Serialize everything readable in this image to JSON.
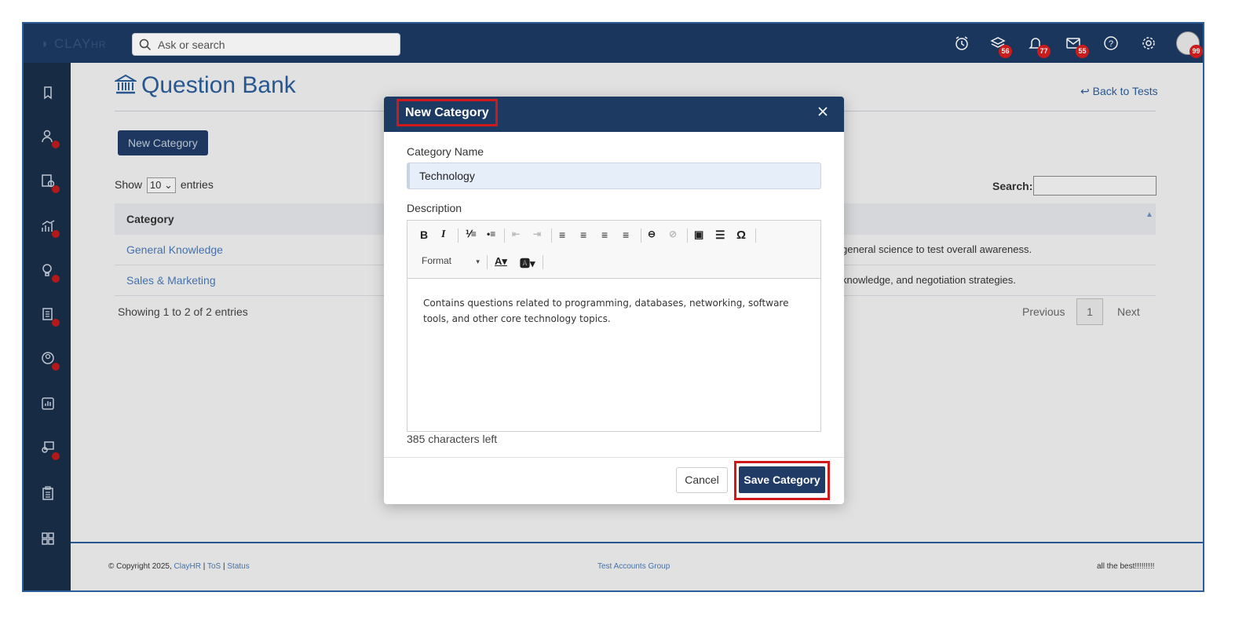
{
  "app": {
    "logo": "CLAY",
    "logo_suffix": "HR",
    "search_placeholder": "Ask or search",
    "badges": {
      "stack": "56",
      "bell": "77",
      "mail": "55",
      "avatar": "99"
    }
  },
  "page": {
    "title": "Question Bank",
    "back_link": "Back to Tests",
    "new_category_button": "New Category",
    "show_label": "Show",
    "entries_value": "10",
    "entries_label": "entries",
    "search_label": "Search:",
    "table": {
      "header": "Category",
      "rows": [
        {
          "category": "General Knowledge",
          "description_fragment": "general science to test overall awareness."
        },
        {
          "category": "Sales & Marketing",
          "description_fragment": "knowledge, and negotiation strategies."
        }
      ]
    },
    "showing_text": "Showing 1 to 2 of 2 entries",
    "pagination": {
      "previous": "Previous",
      "page": "1",
      "next": "Next"
    }
  },
  "footer": {
    "copyright": "© Copyright 2025,",
    "brand_link": "ClayHR",
    "tos": "ToS",
    "status": "Status",
    "sep": "|",
    "center": "Test Accounts Group",
    "right": "all the best!!!!!!!!!"
  },
  "modal": {
    "title": "New Category",
    "category_name_label": "Category Name",
    "category_name_value": "Technology",
    "description_label": "Description",
    "format_label": "Format",
    "description_text": "Contains questions related to programming, databases, networking, software tools, and other core technology topics.",
    "chars_left": "385 characters left",
    "cancel_label": "Cancel",
    "save_label": "Save Category"
  },
  "colors": {
    "brand_navy": "#1d3a63",
    "link_blue": "#2b5d99",
    "highlight_red": "#d01a1a",
    "badge_red": "#d81e1e"
  }
}
